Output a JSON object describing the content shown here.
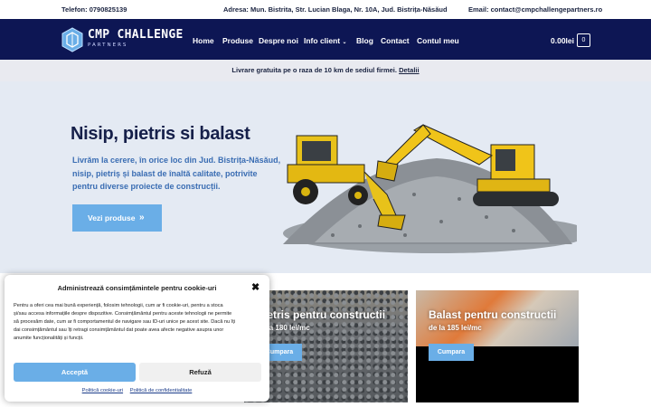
{
  "topbar": {
    "phone": "Telefon: 0790825139",
    "address": "Adresa: Mun. Bistrita, Str. Lucian Blaga, Nr. 10A, Jud. Bistrița-Năsăud",
    "email": "Email: contact@cmpchallengepartners.ro"
  },
  "header": {
    "logo_text": "CMP CHALLENGE",
    "logo_sub": "PARTNERS",
    "nav": [
      "Home",
      "Produse",
      "Despre noi",
      "Info client",
      "Blog",
      "Contact",
      "Contul meu"
    ],
    "cart_total": "0.00lei",
    "cart_count": "0",
    "colors": {
      "header_bg": "#0d1654",
      "accent": "#6aaee7"
    }
  },
  "notice": {
    "text": "Livrare gratuita pe o raza de 10 km de sediul firmei.",
    "link": "Detalii"
  },
  "hero": {
    "title": "Nisip, pietris si balast",
    "text": "Livrăm la cerere, în orice loc din Jud. Bistrița-Năsăud, nisip, pietriș și balast de înaltă calitate, potrivite pentru diverse proiecte de construcții.",
    "button": "Vezi produse",
    "button_icon": "double-chevron-right-icon"
  },
  "cards": [
    {
      "title": "Pietris pentru constructii",
      "price": "de la 180 lei/mc",
      "button": "Cumpara"
    },
    {
      "title": "Balast pentru constructii",
      "price": "de la 185 lei/mc",
      "button": "Cumpara"
    }
  ],
  "cookie": {
    "title": "Administrează consimțămintele pentru cookie-uri",
    "text": "Pentru a oferi cea mai bună experiență, folosim tehnologii, cum ar fi cookie-uri, pentru a stoca și/sau accesa informațiile despre dispozitive. Consimțământul pentru aceste tehnologii ne permite să procesăm date, cum ar fi comportamentul de navigare sau ID-uri unice pe acest site. Dacă nu îți dai consimțământul sau îți retragi consimțământul dat poate avea afecte negative asupra unor anumite funcționalități și funcții.",
    "accept": "Acceptă",
    "refuse": "Refuză",
    "link1": "Politică cookie-uri",
    "link2": "Politică de confidentialitate"
  }
}
